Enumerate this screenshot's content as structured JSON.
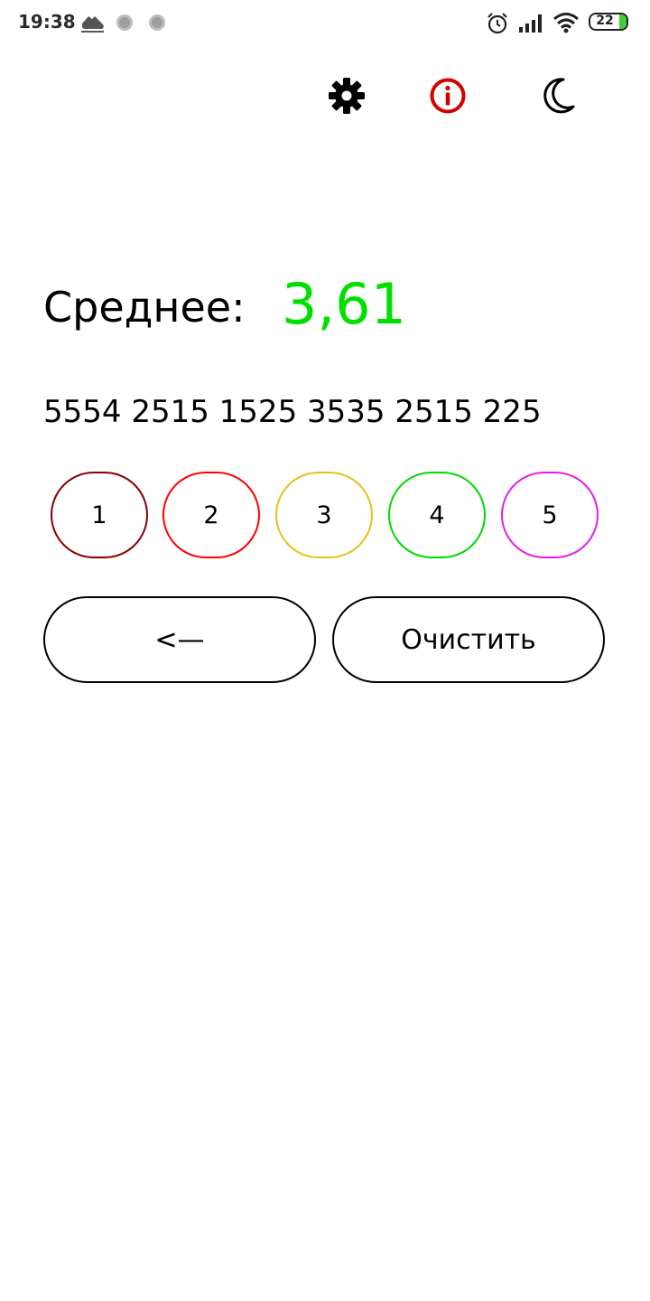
{
  "status_bar": {
    "time": "19:38",
    "battery_level": "22",
    "icons": [
      "running-shoe-icon",
      "notification-dot-icon",
      "notification-dot-icon",
      "alarm-icon",
      "signal-icon",
      "wifi-icon",
      "battery-icon"
    ]
  },
  "toolbar": {
    "icons": [
      "gear-icon",
      "info-icon",
      "moon-icon"
    ],
    "info_color": "#d40000"
  },
  "average": {
    "label": "Среднее:",
    "value": "3,61",
    "value_color": "#00e000"
  },
  "grades_text": "5554 2515 1525 3535 2515 225",
  "grade_buttons": [
    {
      "label": "1",
      "border_color": "#8b0000"
    },
    {
      "label": "2",
      "border_color": "#ff0000"
    },
    {
      "label": "3",
      "border_color": "#e6c21a"
    },
    {
      "label": "4",
      "border_color": "#00d900"
    },
    {
      "label": "5",
      "border_color": "#e61ee6"
    }
  ],
  "actions": {
    "backspace_label": "<—",
    "clear_label": "Очистить"
  }
}
